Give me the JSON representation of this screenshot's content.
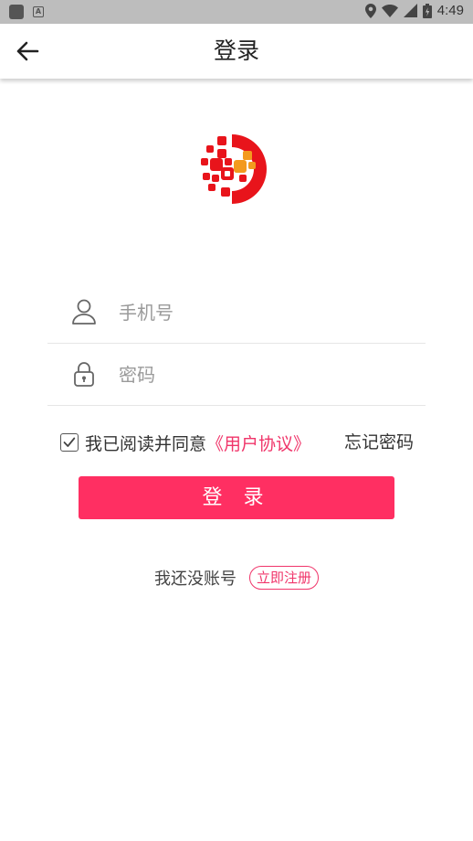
{
  "status_bar": {
    "time": "4:49"
  },
  "header": {
    "title": "登录"
  },
  "form": {
    "phone_placeholder": "手机号",
    "password_placeholder": "密码"
  },
  "agreement": {
    "prefix": "我已阅读并同意",
    "link": "《用户协议》",
    "checked": true
  },
  "forgot_password": "忘记密码",
  "login_button": "登 录",
  "register": {
    "prompt": "我还没账号",
    "link": "立即注册"
  },
  "colors": {
    "accent": "#ff2f62",
    "link": "#f0356a",
    "logo_red": "#e8141b",
    "logo_orange": "#f39a1e"
  },
  "icons": {
    "back": "arrow-left-icon",
    "user": "user-icon",
    "lock": "lock-icon",
    "check": "check-icon"
  }
}
